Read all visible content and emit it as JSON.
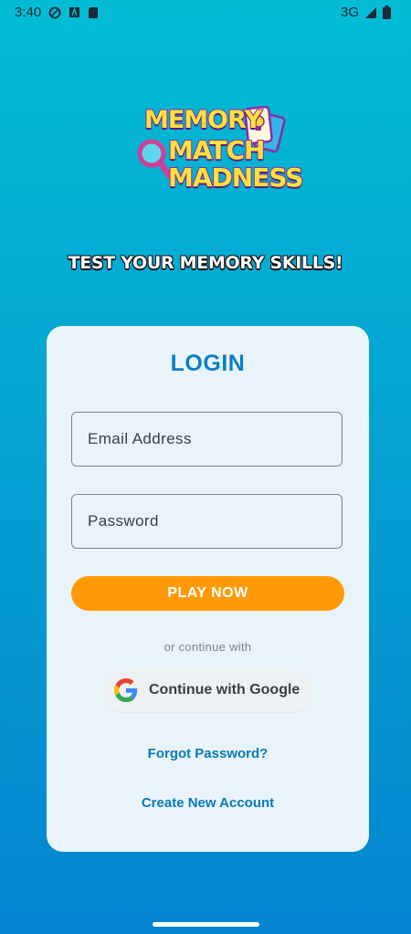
{
  "status_bar": {
    "time": "3:40",
    "network": "3G",
    "icons": [
      "do-not-disturb-icon",
      "app-notification-icon",
      "sd-card-icon",
      "signal-icon",
      "battery-icon"
    ]
  },
  "logo": {
    "line1": "MEMORY",
    "line2": "MATCH",
    "line3": "MADNESS"
  },
  "tagline": "TEST YOUR MEMORY SKILLS!",
  "login": {
    "title": "LOGIN",
    "email_placeholder": "Email Address",
    "password_placeholder": "Password",
    "play_button": "PLAY NOW",
    "or_text": "or continue with",
    "google_button": "Continue with Google",
    "forgot_link": "Forgot Password?",
    "create_link": "Create New Account"
  },
  "colors": {
    "bg_top": "#03bcd4",
    "bg_bottom": "#0385cf",
    "card": "#e8f4fa",
    "accent": "#0d7fc4",
    "play_button": "#ff9a06"
  }
}
